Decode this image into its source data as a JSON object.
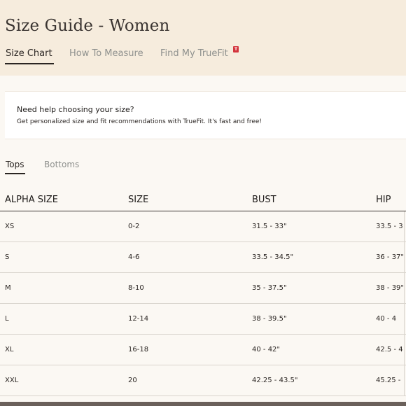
{
  "header": {
    "title": "Size Guide - Women",
    "tabs": [
      {
        "label": "Size Chart",
        "active": true
      },
      {
        "label": "How To Measure",
        "active": false
      },
      {
        "label": "Find My TrueFit",
        "active": false,
        "badge": "T"
      }
    ]
  },
  "help": {
    "title": "Need help choosing your size?",
    "text": "Get personalized size and fit recommendations with TrueFit. It's fast and free!"
  },
  "subtabs": [
    {
      "label": "Tops",
      "active": true
    },
    {
      "label": "Bottoms",
      "active": false
    }
  ],
  "table": {
    "headers": [
      "ALPHA SIZE",
      "SIZE",
      "BUST",
      "HIP"
    ],
    "rows": [
      [
        "XS",
        "0-2",
        "31.5 - 33\"",
        "33.5 - 3"
      ],
      [
        "S",
        "4-6",
        "33.5 - 34.5\"",
        "36 - 37\""
      ],
      [
        "M",
        "8-10",
        "35 - 37.5\"",
        "38 - 39\""
      ],
      [
        "L",
        "12-14",
        "38 - 39.5\"",
        "40 - 4"
      ],
      [
        "XL",
        "16-18",
        "40 - 42\"",
        "42.5 - 4"
      ],
      [
        "XXL",
        "20",
        "42.25 - 43.5\"",
        "45.25 -"
      ]
    ]
  },
  "colors": {
    "header_bg": "#f6ecdd",
    "page_bg": "#fbf8f3",
    "text": "#2a2522",
    "muted": "#8f918e",
    "badge": "#d3343c"
  }
}
